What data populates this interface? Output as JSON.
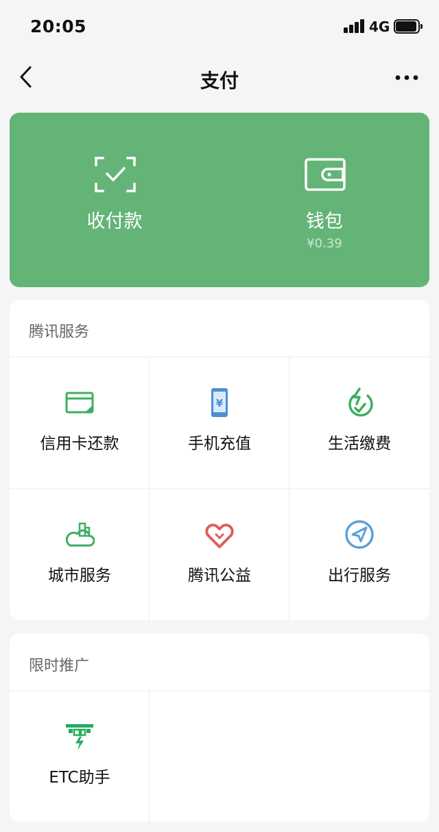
{
  "status": {
    "time": "20:05",
    "network": "4G"
  },
  "nav": {
    "title": "支付"
  },
  "pay_card": {
    "receive": {
      "label": "收付款"
    },
    "wallet": {
      "label": "钱包",
      "balance": "¥0.39"
    },
    "color": "#64b478"
  },
  "tencent_services": {
    "title": "腾讯服务",
    "items": [
      {
        "label": "信用卡还款",
        "icon": "credit-card-icon",
        "color": "#3fae5e"
      },
      {
        "label": "手机充值",
        "icon": "mobile-topup-icon",
        "color": "#4a8fd6"
      },
      {
        "label": "生活缴费",
        "icon": "utility-bill-icon",
        "color": "#3fae5e"
      },
      {
        "label": "城市服务",
        "icon": "city-service-icon",
        "color": "#3fae5e"
      },
      {
        "label": "腾讯公益",
        "icon": "charity-heart-icon",
        "color": "#e05d5d"
      },
      {
        "label": "出行服务",
        "icon": "travel-navigation-icon",
        "color": "#5aa0d8"
      }
    ]
  },
  "promotions": {
    "title": "限时推广",
    "items": [
      {
        "label": "ETC助手",
        "icon": "etc-toll-icon",
        "color": "#1fae5e"
      }
    ]
  }
}
